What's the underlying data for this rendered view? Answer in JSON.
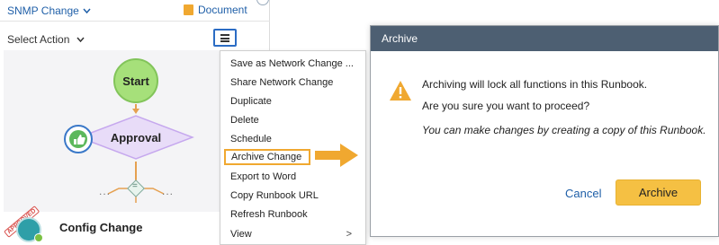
{
  "header": {
    "runbook_name": "SNMP Change",
    "document_link": "Document"
  },
  "toolbar": {
    "select_action": "Select Action"
  },
  "flow": {
    "start_label": "Start",
    "approval_label": "Approval",
    "left_dots": "...",
    "right_dots": "...",
    "gateway_symbol": "=",
    "config_label": "Config Change",
    "approved_stamp": "APPROVED"
  },
  "menu": {
    "items": [
      "Save as Network Change ...",
      "Share Network Change",
      "Duplicate",
      "Delete",
      "Schedule",
      "Archive Change",
      "Export to Word",
      "Copy Runbook URL",
      "Refresh Runbook",
      "View"
    ],
    "highlighted_index": 5,
    "submenu_chevron": ">"
  },
  "dialog": {
    "title": "Archive",
    "message_line1": "Archiving will lock all functions in this Runbook.",
    "message_line2": "Are you sure you want to proceed?",
    "message_note": "You can make changes by creating a copy of this Runbook.",
    "cancel_label": "Cancel",
    "archive_label": "Archive"
  },
  "icons": {
    "chevron": "chevron-down-icon",
    "document": "document-icon",
    "menu": "hamburger-menu-icon",
    "warning": "warning-icon",
    "approval": "thumbs-up-icon",
    "config": "config-change-icon",
    "callout": "arrow-right-icon"
  },
  "colors": {
    "accent_blue": "#1f5fa8",
    "highlight_orange": "#f0a830",
    "dialog_header": "#4d5f72",
    "archive_button": "#f5c043",
    "start_node": "#a6e07a",
    "approval_node": "#e8dcf8",
    "warning": "#f0a830"
  }
}
